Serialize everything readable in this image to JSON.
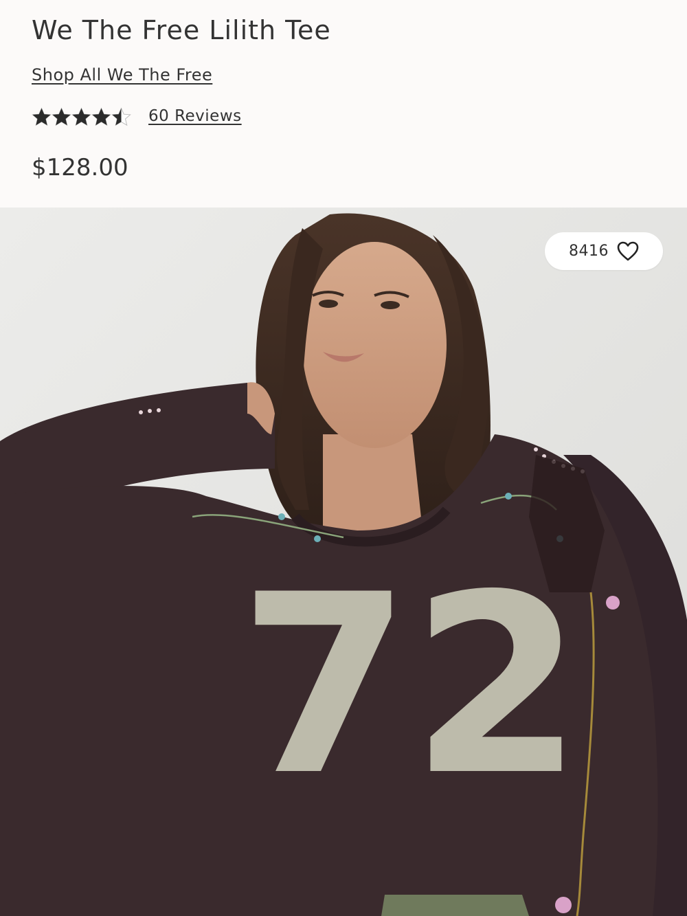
{
  "product": {
    "title": "We The Free Lilith Tee",
    "shop_all_label": "Shop All We The Free",
    "rating": 4.5,
    "rating_max": 5,
    "reviews_label": "60 Reviews",
    "price": "$128.00"
  },
  "image": {
    "favorites_count": "8416",
    "favorite_icon": "heart-outline-icon",
    "shirt_number": "72"
  },
  "colors": {
    "text": "#333333",
    "background": "#fcfaf9",
    "shirt": "#3a2a2d",
    "number_print": "#c9c8b6"
  }
}
